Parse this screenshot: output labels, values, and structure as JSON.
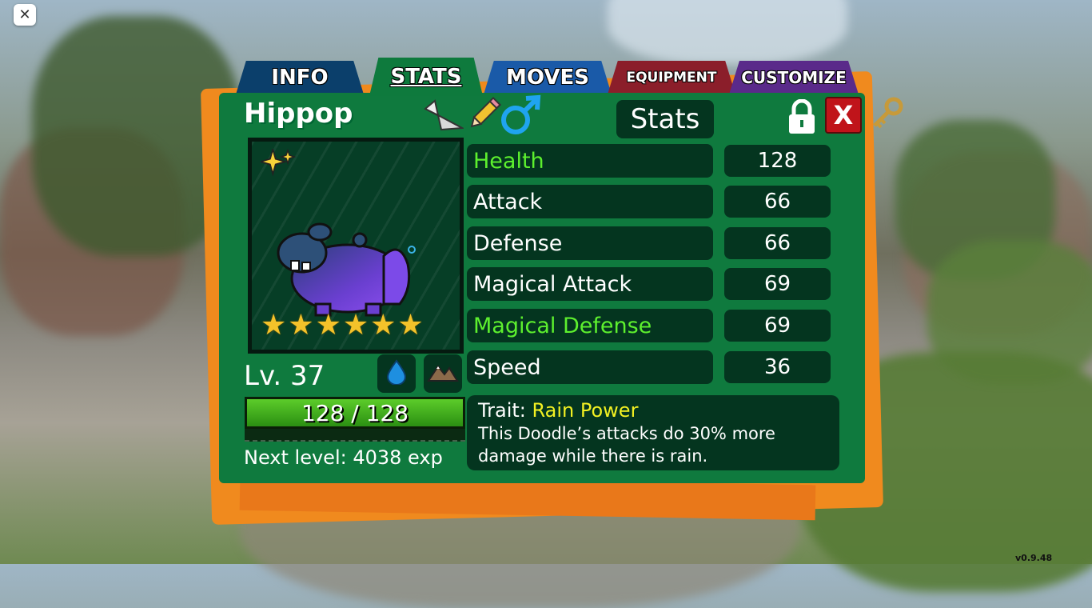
{
  "tabs": {
    "info": "INFO",
    "stats": "STATS",
    "moves": "MOVES",
    "equipment": "EQUIPMENT",
    "customize": "CUSTOMIZE"
  },
  "doodle": {
    "name": "Hippop",
    "level_label": "Lv. 37",
    "stars": 6,
    "hp_text": "128 / 128",
    "hp_fraction": 1.0,
    "next_level": "Next level: 4038 exp"
  },
  "header": {
    "stats_label": "Stats",
    "close_label": "X"
  },
  "stats": [
    {
      "label": "Health",
      "value": "128",
      "highlight": true
    },
    {
      "label": "Attack",
      "value": "66",
      "highlight": false
    },
    {
      "label": "Defense",
      "value": "66",
      "highlight": false
    },
    {
      "label": "Magical Attack",
      "value": "69",
      "highlight": false
    },
    {
      "label": "Magical Defense",
      "value": "69",
      "highlight": true
    },
    {
      "label": "Speed",
      "value": "36",
      "highlight": false
    }
  ],
  "trait": {
    "label": "Trait:",
    "name": "Rain Power",
    "description_line1": "This Doodle’s attacks do 30% more",
    "description_line2": "damage while there is rain."
  },
  "icons": {
    "plane": "paper-plane-icon",
    "pencil": "pencil-icon",
    "gender": "male-icon",
    "lock": "lock-icon",
    "key": "key-icon",
    "water": "water-drop-icon",
    "earth": "mountain-icon"
  },
  "colors": {
    "panel": "#0f7a3e",
    "highlight_green": "#5df02e",
    "trait_yellow": "#f2f022",
    "close_red": "#c0141a"
  },
  "screen": {
    "close_label": "✕",
    "version": "v0.9.48"
  }
}
